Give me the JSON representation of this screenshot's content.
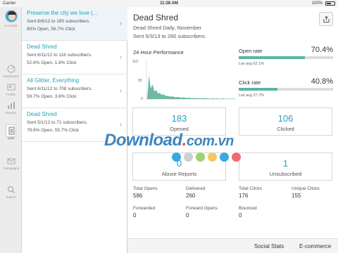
{
  "status_bar": {
    "carrier": "Carrier",
    "time": "11:38 AM",
    "battery": "100%"
  },
  "rail": {
    "items": [
      {
        "label": "Accounts",
        "icon": "avatar"
      },
      {
        "label": "Dashboard",
        "icon": "dashboard-icon"
      },
      {
        "label": "Profile",
        "icon": "profile-icon"
      },
      {
        "label": "Reports",
        "icon": "bar-chart-icon"
      },
      {
        "label": "Lists",
        "icon": "lists-icon"
      },
      {
        "label": "Campaigns",
        "icon": "envelope-icon"
      },
      {
        "label": "Search",
        "icon": "search-icon"
      }
    ]
  },
  "campaigns": [
    {
      "title": "Preserve the city we love (...",
      "sent": "Sent 8/6/12 to 180 subscribers.",
      "stats": "80% Open, 56.7% Click"
    },
    {
      "title": "Dead Shred",
      "sent": "Sent 6/11/12 to 116 subscribers.",
      "stats": "52.6% Open, 1.8% Click"
    },
    {
      "title": "All Glitter, Everything",
      "sent": "Sent 6/11/12 to 708 subscribers.",
      "stats": "59.7% Open, 3.6% Click"
    },
    {
      "title": "Dead Shred",
      "sent": "Sent 5/1/12 to 71 subscribers.",
      "stats": "78.6% Open, 55.7% Click"
    }
  ],
  "detail": {
    "title": "Dead Shred",
    "list_name": "Dead Shred Daily, November",
    "sent_info": "Sent 5/3/13 to 260 subscribers.",
    "perf_title": "24 Hour Performance",
    "open_rate": {
      "label": "Open rate",
      "value": "70.4%",
      "fraction": 0.704,
      "avg": "List avg 62.1%"
    },
    "click_rate": {
      "label": "Click rate",
      "value": "40.8%",
      "fraction": 0.408,
      "avg": "List avg 27.7%"
    },
    "opened": {
      "value": "183",
      "label": "Opened"
    },
    "clicked": {
      "value": "106",
      "label": "Clicked"
    },
    "abuse": {
      "value": "0",
      "label": "Abuse Reports"
    },
    "unsubscribed": {
      "value": "1",
      "label": "Unsubscribed"
    },
    "kpis": [
      {
        "label": "Total Opens",
        "value": "586"
      },
      {
        "label": "Delivered",
        "value": "260"
      },
      {
        "label": "Total Clicks",
        "value": "176"
      },
      {
        "label": "Unique Clicks",
        "value": "155"
      },
      {
        "label": "Forwarded",
        "value": "0"
      },
      {
        "label": "Forward Opens",
        "value": "0"
      },
      {
        "label": "Bounced",
        "value": "0"
      }
    ],
    "tabs": [
      "Social Stats",
      "E-commerce"
    ]
  },
  "watermark": {
    "text": "Download",
    "dot": ".",
    "tld": "com.vn"
  },
  "dots_colors": [
    "#3aa8e0",
    "#cfcfcf",
    "#9fd36d",
    "#f5c66a",
    "#3aa8e0",
    "#ef6b73"
  ],
  "colors": {
    "accent": "#27a2b9",
    "bar_fill": "#5ab5a2",
    "chart_fill": "#6fb8a6"
  },
  "chart_data": {
    "type": "area",
    "title": "24 Hour Performance",
    "y_ticks": [
      "110",
      "55",
      "0"
    ],
    "ylim": [
      0,
      110
    ],
    "series": [
      {
        "values": [
          3,
          68,
          30,
          42,
          22,
          26,
          16,
          18,
          12,
          14,
          10,
          9,
          8,
          7,
          8,
          6,
          5,
          6,
          5,
          4,
          5,
          4,
          3,
          4,
          3,
          3,
          3,
          2,
          3,
          2,
          2,
          3,
          2,
          2,
          2,
          1,
          2,
          2,
          1,
          2,
          1,
          1,
          2,
          1,
          1,
          1,
          1,
          1,
          1,
          1
        ]
      }
    ]
  }
}
